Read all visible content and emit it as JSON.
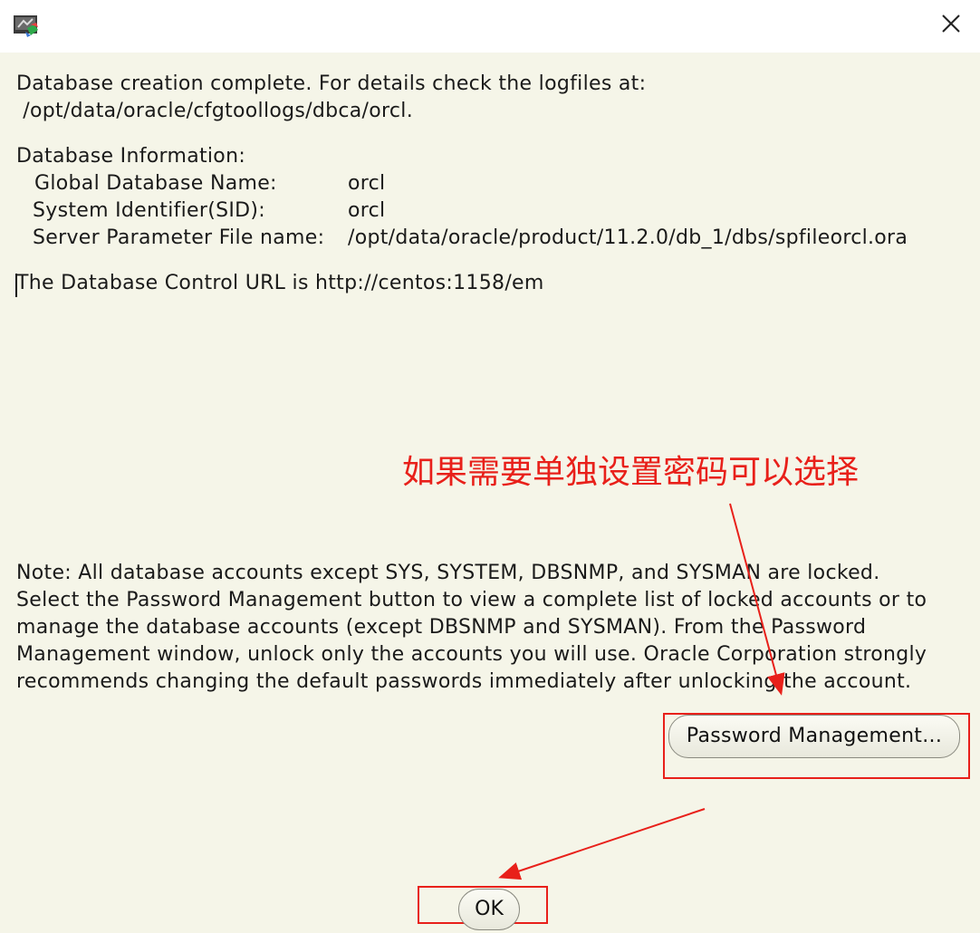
{
  "window": {
    "app_icon": "oracle-dbca-icon",
    "close_icon": "close-icon"
  },
  "message": {
    "line1": "Database creation complete. For details check the logfiles at:",
    "line2": " /opt/data/oracle/cfgtoollogs/dbca/orcl."
  },
  "db_info": {
    "heading": "Database Information:",
    "rows": [
      {
        "label": "Global Database Name:",
        "value": "orcl"
      },
      {
        "label": "System Identifier(SID):",
        "value": "orcl"
      },
      {
        "label": "Server Parameter File name:",
        "value": "/opt/data/oracle/product/11.2.0/db_1/dbs/spfileorcl.ora"
      }
    ]
  },
  "control_url": "The Database Control URL is http://centos:1158/em",
  "annotation": "如果需要单独设置密码可以选择",
  "note": [
    "Note: All database accounts except SYS, SYSTEM, DBSNMP, and SYSMAN are locked.",
    "Select the Password Management button to view a complete list of locked accounts or to",
    "manage the database accounts (except DBSNMP and SYSMAN). From the Password",
    "Management window, unlock only the accounts you will use. Oracle Corporation strongly",
    "recommends changing the default passwords immediately after unlocking the account."
  ],
  "buttons": {
    "password_management": "Password Management...",
    "ok": "OK"
  },
  "colors": {
    "background": "#f5f5e8",
    "annotation": "#e8201a"
  }
}
